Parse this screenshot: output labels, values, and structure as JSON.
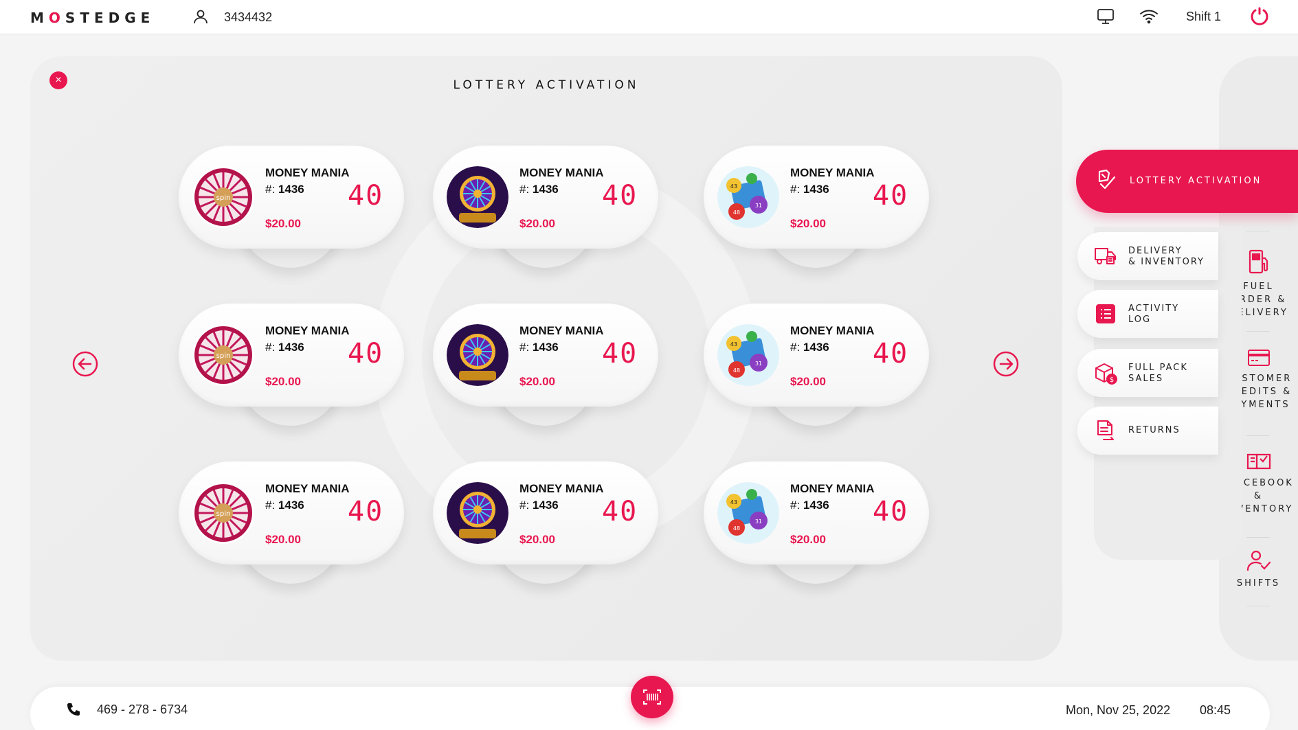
{
  "header": {
    "logo": "MOSTEDGE",
    "user_id": "3434432",
    "shift": "Shift 1"
  },
  "panel": {
    "title": "LOTTERY ACTIVATION",
    "close_label": "×"
  },
  "cards": [
    {
      "name": "MONEY MANIA",
      "num_prefix": "#:",
      "num": "1436",
      "count": "40",
      "price": "$20.00",
      "art": "spin-wheel"
    },
    {
      "name": "MONEY MANIA",
      "num_prefix": "#:",
      "num": "1436",
      "count": "40",
      "price": "$20.00",
      "art": "purple-wheel"
    },
    {
      "name": "MONEY MANIA",
      "num_prefix": "#:",
      "num": "1436",
      "count": "40",
      "price": "$20.00",
      "art": "bingo-balls"
    },
    {
      "name": "MONEY MANIA",
      "num_prefix": "#:",
      "num": "1436",
      "count": "40",
      "price": "$20.00",
      "art": "spin-wheel"
    },
    {
      "name": "MONEY MANIA",
      "num_prefix": "#:",
      "num": "1436",
      "count": "40",
      "price": "$20.00",
      "art": "purple-wheel"
    },
    {
      "name": "MONEY MANIA",
      "num_prefix": "#:",
      "num": "1436",
      "count": "40",
      "price": "$20.00",
      "art": "bingo-balls"
    },
    {
      "name": "MONEY MANIA",
      "num_prefix": "#:",
      "num": "1436",
      "count": "40",
      "price": "$20.00",
      "art": "spin-wheel"
    },
    {
      "name": "MONEY MANIA",
      "num_prefix": "#:",
      "num": "1436",
      "count": "40",
      "price": "$20.00",
      "art": "purple-wheel"
    },
    {
      "name": "MONEY MANIA",
      "num_prefix": "#:",
      "num": "1436",
      "count": "40",
      "price": "$20.00",
      "art": "bingo-balls"
    }
  ],
  "submenu": {
    "active": "LOTTERY ACTIVATION",
    "items": [
      {
        "label": "DELIVERY\n& INVENTORY",
        "icon": "delivery-truck-icon"
      },
      {
        "label": "ACTIVITY\nLOG",
        "icon": "list-icon"
      },
      {
        "label": "FULL PACK\nSALES",
        "icon": "package-dollar-icon"
      },
      {
        "label": "RETURNS",
        "icon": "return-document-icon"
      }
    ]
  },
  "rail": [
    {
      "label": "FUEL\nORDER &\nDELIVERY",
      "icon": "fuel-pump-icon"
    },
    {
      "label": "CUSTOMER\nCREDITS &\nPAYMENTS",
      "icon": "credit-card-icon"
    },
    {
      "label": "PRICEBOOK\n&\nINVENTORY",
      "icon": "pricebook-icon"
    },
    {
      "label": "SHIFTS",
      "icon": "user-check-icon"
    }
  ],
  "footer": {
    "phone": "469 - 278 - 6734",
    "date": "Mon, Nov 25, 2022",
    "time": "08:45"
  },
  "colors": {
    "accent": "#e8174f",
    "background": "#f4f4f5",
    "panel": "#ececec"
  }
}
